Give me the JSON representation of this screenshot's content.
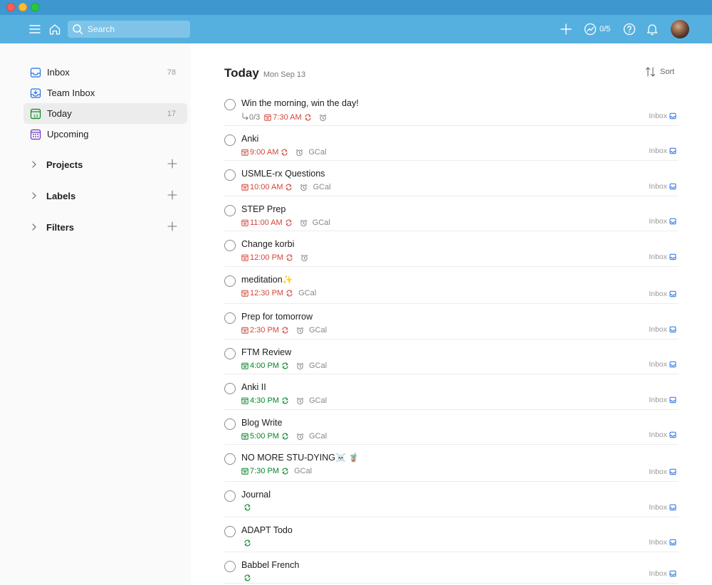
{
  "topbar": {
    "search_placeholder": "Search",
    "karma_count": "0/5"
  },
  "sidebar": {
    "items": [
      {
        "label": "Inbox",
        "count": "78",
        "icon": "inbox-icon",
        "active": false
      },
      {
        "label": "Team Inbox",
        "count": "",
        "icon": "team-inbox-icon",
        "active": false
      },
      {
        "label": "Today",
        "count": "17",
        "icon": "today-calendar-icon",
        "active": true
      },
      {
        "label": "Upcoming",
        "count": "",
        "icon": "upcoming-calendar-icon",
        "active": false
      }
    ],
    "sections": [
      {
        "label": "Projects"
      },
      {
        "label": "Labels"
      },
      {
        "label": "Filters"
      }
    ]
  },
  "main": {
    "title": "Today",
    "date": "Mon Sep 13",
    "sort_label": "Sort",
    "tasks": [
      {
        "name": "Win the morning, win the day!",
        "emoji": "",
        "subtasks": "0/3",
        "time": "7:30 AM",
        "color": "red",
        "recurring": true,
        "alarm": true,
        "gcal": "",
        "project": "Inbox"
      },
      {
        "name": "Anki",
        "emoji": "",
        "subtasks": "",
        "time": "9:00 AM",
        "color": "red",
        "recurring": true,
        "alarm": true,
        "gcal": "GCal",
        "project": "Inbox"
      },
      {
        "name": "USMLE-rx Questions",
        "emoji": "",
        "subtasks": "",
        "time": "10:00 AM",
        "color": "red",
        "recurring": true,
        "alarm": true,
        "gcal": "GCal",
        "project": "Inbox"
      },
      {
        "name": "STEP Prep",
        "emoji": "",
        "subtasks": "",
        "time": "11:00 AM",
        "color": "red",
        "recurring": true,
        "alarm": true,
        "gcal": "GCal",
        "project": "Inbox"
      },
      {
        "name": "Change korbi",
        "emoji": "",
        "subtasks": "",
        "time": "12:00 PM",
        "color": "red",
        "recurring": true,
        "alarm": true,
        "gcal": "",
        "project": "Inbox"
      },
      {
        "name": "meditation",
        "emoji": "✨",
        "subtasks": "",
        "time": "12:30 PM",
        "color": "red",
        "recurring": true,
        "alarm": false,
        "gcal": "GCal",
        "project": "Inbox"
      },
      {
        "name": "Prep for tomorrow",
        "emoji": "",
        "subtasks": "",
        "time": "2:30 PM",
        "color": "red",
        "recurring": true,
        "alarm": true,
        "gcal": "GCal",
        "project": "Inbox"
      },
      {
        "name": "FTM Review",
        "emoji": "",
        "subtasks": "",
        "time": "4:00 PM",
        "color": "green",
        "recurring": true,
        "alarm": true,
        "gcal": "GCal",
        "project": "Inbox"
      },
      {
        "name": "Anki II",
        "emoji": "",
        "subtasks": "",
        "time": "4:30 PM",
        "color": "green",
        "recurring": true,
        "alarm": true,
        "gcal": "GCal",
        "project": "Inbox"
      },
      {
        "name": "Blog Write",
        "emoji": "",
        "subtasks": "",
        "time": "5:00 PM",
        "color": "green",
        "recurring": true,
        "alarm": true,
        "gcal": "GCal",
        "project": "Inbox"
      },
      {
        "name": "NO MORE STU-DYING",
        "emoji": "☠️ 🧋",
        "subtasks": "",
        "time": "7:30 PM",
        "color": "green",
        "recurring": true,
        "alarm": false,
        "gcal": "GCal",
        "project": "Inbox"
      },
      {
        "name": "Journal",
        "emoji": "",
        "subtasks": "",
        "time": "",
        "color": "green",
        "recurring": true,
        "alarm": false,
        "gcal": "",
        "project": "Inbox"
      },
      {
        "name": "ADAPT Todo",
        "emoji": "",
        "subtasks": "",
        "time": "",
        "color": "green",
        "recurring": true,
        "alarm": false,
        "gcal": "",
        "project": "Inbox"
      },
      {
        "name": "Babbel French",
        "emoji": "",
        "subtasks": "",
        "time": "",
        "color": "green",
        "recurring": true,
        "alarm": false,
        "gcal": "",
        "project": "Inbox"
      }
    ]
  },
  "colors": {
    "titlebar": "#3e97cf",
    "topbar": "#55b0e0",
    "overdue_red": "#d1453b",
    "today_green": "#058527",
    "sidebar_bg": "#fafafa"
  }
}
